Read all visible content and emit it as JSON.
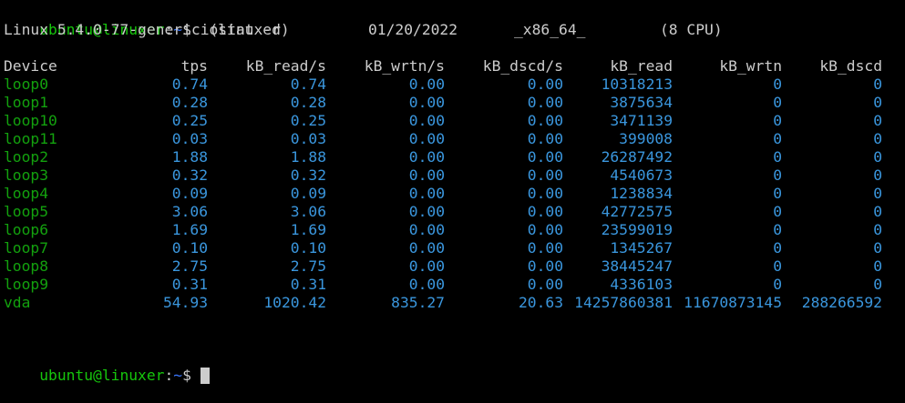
{
  "prompt": {
    "user_host": "ubuntu@linuxer",
    "separator": ":",
    "path": "~",
    "symbol": "$"
  },
  "command": " iostat -d",
  "sysinfo": {
    "kernel": "Linux 5.4.0-77-generic (linuxer)",
    "date": "01/20/2022",
    "arch": "_x86_64_",
    "cpu": "(8 CPU)"
  },
  "table": {
    "headers": [
      "Device",
      "tps",
      "kB_read/s",
      "kB_wrtn/s",
      "kB_dscd/s",
      "kB_read",
      "kB_wrtn",
      "kB_dscd"
    ],
    "rows": [
      [
        "loop0",
        "0.74",
        "0.74",
        "0.00",
        "0.00",
        "10318213",
        "0",
        "0"
      ],
      [
        "loop1",
        "0.28",
        "0.28",
        "0.00",
        "0.00",
        "3875634",
        "0",
        "0"
      ],
      [
        "loop10",
        "0.25",
        "0.25",
        "0.00",
        "0.00",
        "3471139",
        "0",
        "0"
      ],
      [
        "loop11",
        "0.03",
        "0.03",
        "0.00",
        "0.00",
        "399008",
        "0",
        "0"
      ],
      [
        "loop2",
        "1.88",
        "1.88",
        "0.00",
        "0.00",
        "26287492",
        "0",
        "0"
      ],
      [
        "loop3",
        "0.32",
        "0.32",
        "0.00",
        "0.00",
        "4540673",
        "0",
        "0"
      ],
      [
        "loop4",
        "0.09",
        "0.09",
        "0.00",
        "0.00",
        "1238834",
        "0",
        "0"
      ],
      [
        "loop5",
        "3.06",
        "3.06",
        "0.00",
        "0.00",
        "42772575",
        "0",
        "0"
      ],
      [
        "loop6",
        "1.69",
        "1.69",
        "0.00",
        "0.00",
        "23599019",
        "0",
        "0"
      ],
      [
        "loop7",
        "0.10",
        "0.10",
        "0.00",
        "0.00",
        "1345267",
        "0",
        "0"
      ],
      [
        "loop8",
        "2.75",
        "2.75",
        "0.00",
        "0.00",
        "38445247",
        "0",
        "0"
      ],
      [
        "loop9",
        "0.31",
        "0.31",
        "0.00",
        "0.00",
        "4336103",
        "0",
        "0"
      ],
      [
        "vda",
        "54.93",
        "1020.42",
        "835.27",
        "20.63",
        "14257860381",
        "11670873145",
        "288266592"
      ]
    ]
  },
  "colors": {
    "background": "#000000",
    "foreground": "#cccccc",
    "user_host": "#16c60c",
    "path": "#3b78ff",
    "device": "#13a10e",
    "number": "#3a96dd"
  }
}
